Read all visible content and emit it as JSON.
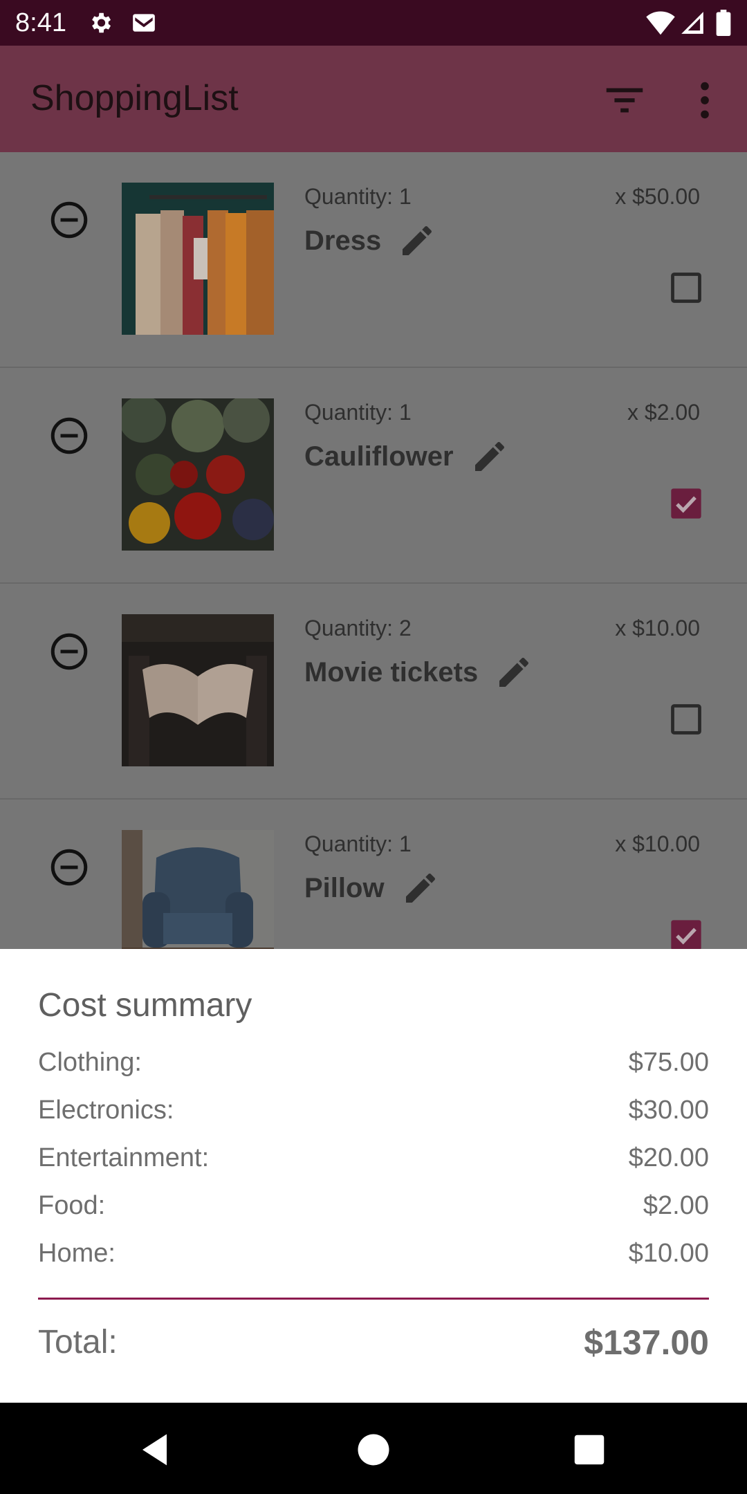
{
  "status_bar": {
    "time": "8:41",
    "icons_left": [
      "settings-icon",
      "gmail-icon"
    ],
    "icons_right": [
      "wifi-icon",
      "signal-icon",
      "battery-icon"
    ]
  },
  "app_bar": {
    "title": "ShoppingList",
    "actions": [
      "filter-icon",
      "more-vert-icon"
    ]
  },
  "items": [
    {
      "quantity": "Quantity: 1",
      "price": "x $50.00",
      "name": "Dress",
      "checked": false,
      "image": "clothes-rack-photo"
    },
    {
      "quantity": "Quantity: 1",
      "price": "x $2.00",
      "name": "Cauliflower",
      "checked": true,
      "image": "vegetables-photo"
    },
    {
      "quantity": "Quantity: 2",
      "price": "x $10.00",
      "name": "Movie tickets",
      "checked": false,
      "image": "open-book-photo"
    },
    {
      "quantity": "Quantity: 1",
      "price": "x $10.00",
      "name": "Pillow",
      "checked": true,
      "image": "armchair-photo"
    }
  ],
  "cost_summary": {
    "title": "Cost summary",
    "rows": [
      {
        "label": "Clothing:",
        "value": "$75.00"
      },
      {
        "label": "Electronics:",
        "value": "$30.00"
      },
      {
        "label": "Entertainment:",
        "value": "$20.00"
      },
      {
        "label": "Food:",
        "value": "$2.00"
      },
      {
        "label": "Home:",
        "value": "$10.00"
      }
    ],
    "total_label": "Total:",
    "total_value": "$137.00"
  },
  "nav_bar": {
    "buttons": [
      "back-icon",
      "home-icon",
      "recents-icon"
    ]
  },
  "colors": {
    "status_bar": "#3a0a21",
    "app_bar_dimmed": "#6e3448",
    "accent": "#8c1b4f",
    "scrim": "#767676"
  }
}
